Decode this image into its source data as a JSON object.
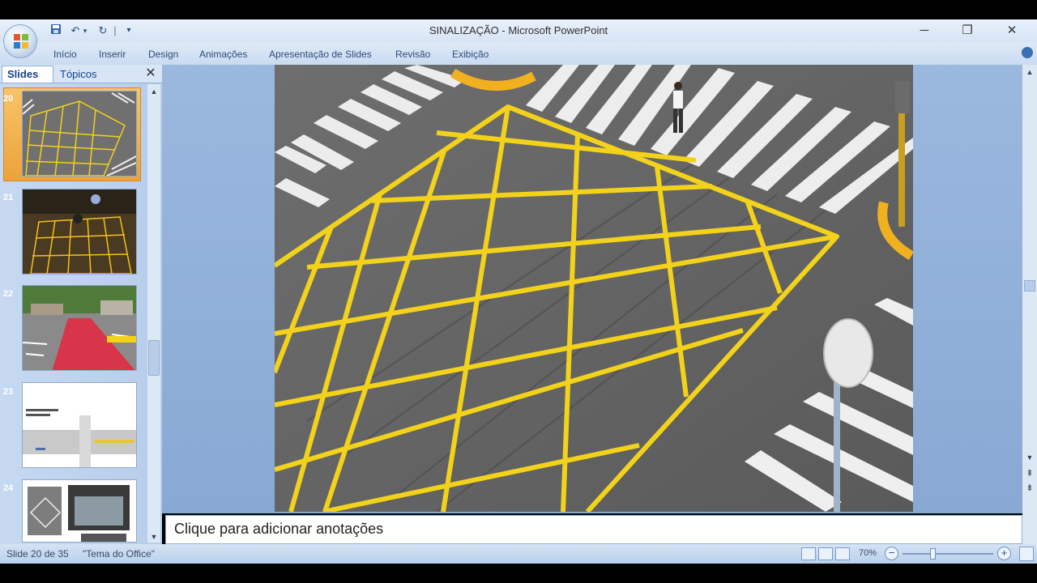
{
  "window": {
    "title": "SINALIZAÇÃO - Microsoft PowerPoint"
  },
  "quick_access": {
    "icons": [
      "save-icon",
      "undo-icon",
      "redo-icon",
      "customize-icon"
    ]
  },
  "window_controls": {
    "minimize": "─",
    "restore": "❐",
    "close": "✕"
  },
  "ribbon": {
    "tabs": [
      "Início",
      "Inserir",
      "Design",
      "Animações",
      "Apresentação de Slides",
      "Revisão",
      "Exibição"
    ]
  },
  "left_pane": {
    "tab_slides": "Slides",
    "tab_topics": "Tópicos",
    "close": "✕",
    "slides": [
      {
        "number": "20",
        "selected": true
      },
      {
        "number": "21",
        "selected": false
      },
      {
        "number": "22",
        "selected": false
      },
      {
        "number": "23",
        "selected": false
      },
      {
        "number": "24",
        "selected": false
      }
    ]
  },
  "notes": {
    "placeholder": "Clique para adicionar anotações"
  },
  "status": {
    "slide_info": "Slide 20 de 35",
    "theme": "\"Tema do Office\"",
    "zoom": "70%"
  },
  "colors": {
    "road_marking": "#f2d21b",
    "selection": "#f0ae45",
    "accent": "#15428b"
  }
}
